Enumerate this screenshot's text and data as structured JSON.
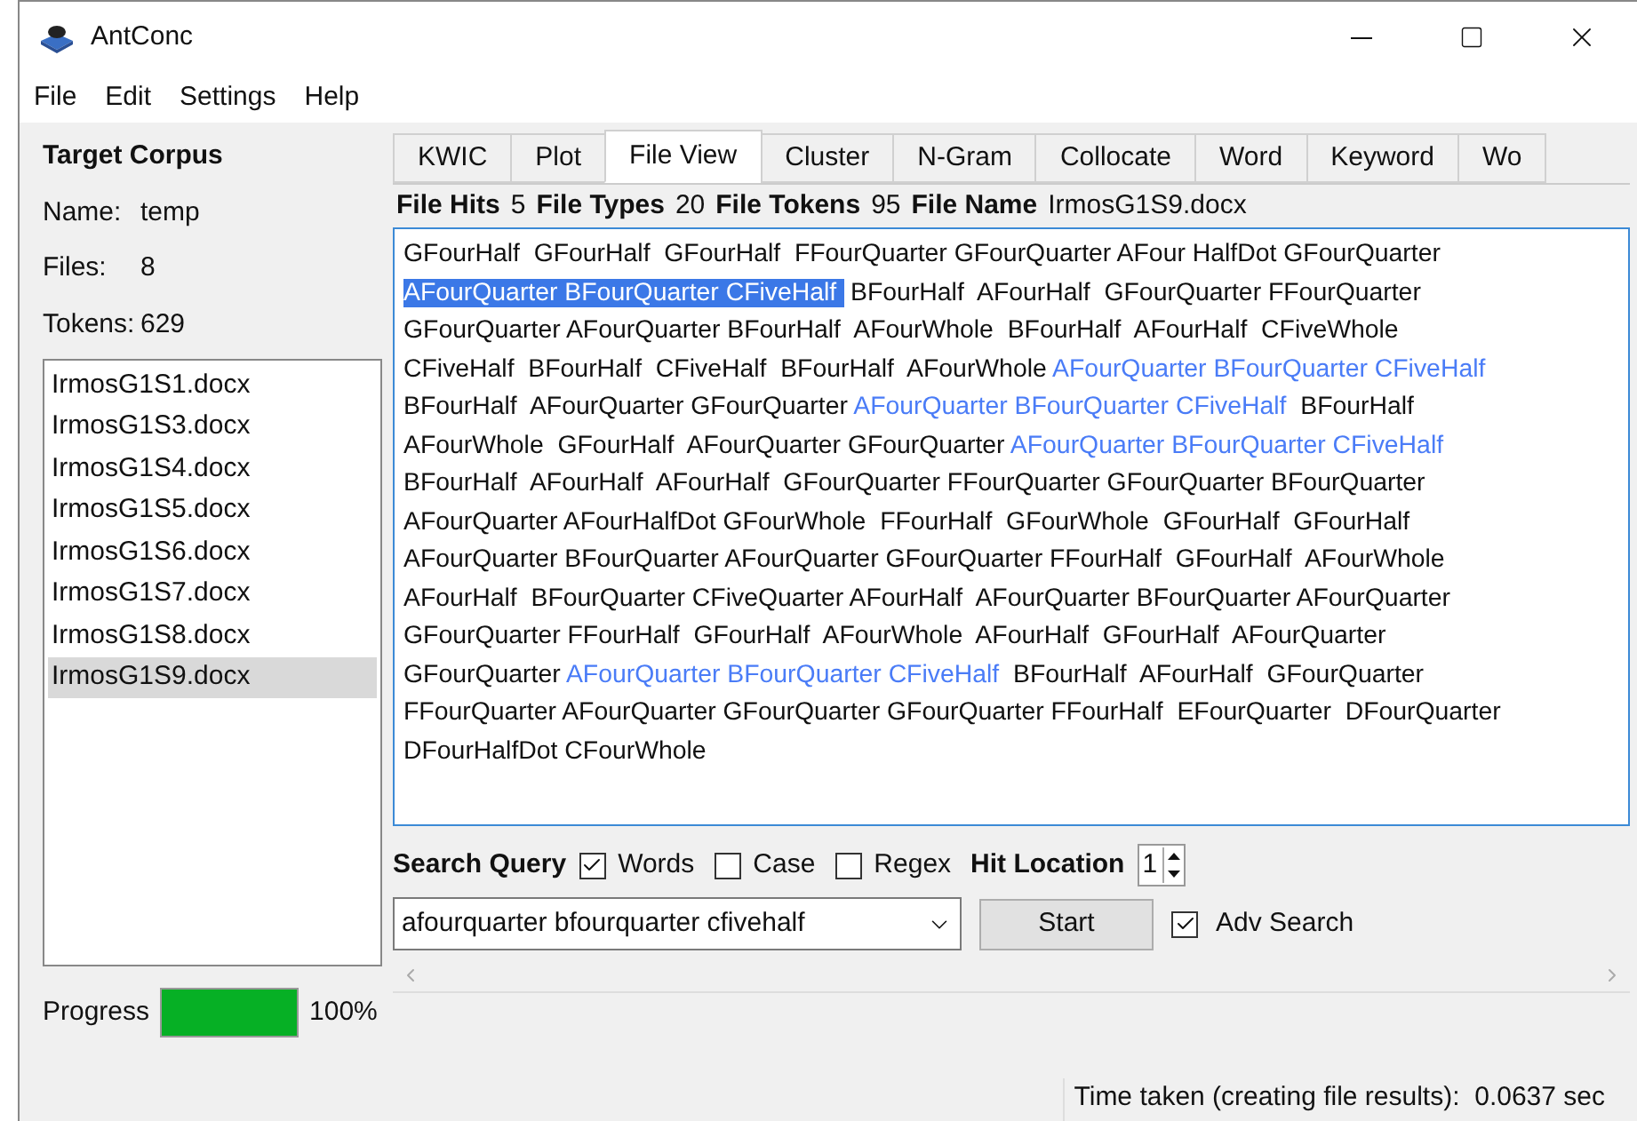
{
  "window": {
    "title": "AntConc"
  },
  "menu": [
    "File",
    "Edit",
    "Settings",
    "Help"
  ],
  "corpus": {
    "heading": "Target Corpus",
    "fields": [
      {
        "label": "Name:",
        "value": "temp"
      },
      {
        "label": "Files:",
        "value": "8"
      },
      {
        "label": "Tokens:",
        "value": "629"
      }
    ],
    "files": [
      {
        "name": "IrmosG1S1.docx",
        "selected": false
      },
      {
        "name": "IrmosG1S3.docx",
        "selected": false
      },
      {
        "name": "IrmosG1S4.docx",
        "selected": false
      },
      {
        "name": "IrmosG1S5.docx",
        "selected": false
      },
      {
        "name": "IrmosG1S6.docx",
        "selected": false
      },
      {
        "name": "IrmosG1S7.docx",
        "selected": false
      },
      {
        "name": "IrmosG1S8.docx",
        "selected": false
      },
      {
        "name": "IrmosG1S9.docx",
        "selected": true
      }
    ]
  },
  "progress": {
    "label": "Progress",
    "level": 1,
    "reading": "100%"
  },
  "tabs": [
    {
      "label": "KWIC",
      "selected": false
    },
    {
      "label": "Plot",
      "selected": false
    },
    {
      "label": "File View",
      "selected": true
    },
    {
      "label": "Cluster",
      "selected": false
    },
    {
      "label": "N-Gram",
      "selected": false
    },
    {
      "label": "Collocate",
      "selected": false
    },
    {
      "label": "Word",
      "selected": false
    },
    {
      "label": "Keyword",
      "selected": false
    },
    {
      "label": "Wo",
      "selected": false
    }
  ],
  "stats": [
    {
      "label": "File Hits",
      "value": "5"
    },
    {
      "label": "File Types",
      "value": "20"
    },
    {
      "label": "File Tokens",
      "value": "95"
    },
    {
      "label": "File Name",
      "value": "IrmosG1S9.docx"
    }
  ],
  "file_view": {
    "lines": [
      [
        {
          "kind": "plain",
          "text": "GFourHalf  GFourHalf  GFourHalf  FFourQuarter GFourQuarter AFour HalfDot GFourQuarter"
        }
      ],
      [
        {
          "kind": "selected",
          "text": "AFourQuarter BFourQuarter CFiveHalf "
        },
        {
          "kind": "plain",
          "text": " BFourHalf  AFourHalf  GFourQuarter FFourQuarter"
        }
      ],
      [
        {
          "kind": "plain",
          "text": "GFourQuarter AFourQuarter BFourHalf  AFourWhole  BFourHalf  AFourHalf  CFiveWhole"
        }
      ],
      [
        {
          "kind": "plain",
          "text": "CFiveHalf  BFourHalf  CFiveHalf  BFourHalf  AFourWhole "
        },
        {
          "kind": "hit",
          "text": "AFourQuarter BFourQuarter CFiveHalf"
        }
      ],
      [
        {
          "kind": "plain",
          "text": "BFourHalf  AFourQuarter GFourQuarter "
        },
        {
          "kind": "hit",
          "text": "AFourQuarter BFourQuarter CFiveHalf"
        },
        {
          "kind": "plain",
          "text": "  BFourHalf"
        }
      ],
      [
        {
          "kind": "plain",
          "text": "AFourWhole  GFourHalf  AFourQuarter GFourQuarter "
        },
        {
          "kind": "hit",
          "text": "AFourQuarter BFourQuarter CFiveHalf"
        }
      ],
      [
        {
          "kind": "plain",
          "text": "BFourHalf  AFourHalf  AFourHalf  GFourQuarter FFourQuarter GFourQuarter BFourQuarter"
        }
      ],
      [
        {
          "kind": "plain",
          "text": "AFourQuarter AFourHalfDot GFourWhole  FFourHalf  GFourWhole  GFourHalf  GFourHalf"
        }
      ],
      [
        {
          "kind": "plain",
          "text": "AFourQuarter BFourQuarter AFourQuarter GFourQuarter FFourHalf  GFourHalf  AFourWhole"
        }
      ],
      [
        {
          "kind": "plain",
          "text": "AFourHalf  BFourQuarter CFiveQuarter AFourHalf  AFourQuarter BFourQuarter AFourQuarter"
        }
      ],
      [
        {
          "kind": "plain",
          "text": "GFourQuarter FFourHalf  GFourHalf  AFourWhole  AFourHalf  GFourHalf  AFourQuarter"
        }
      ],
      [
        {
          "kind": "plain",
          "text": "GFourQuarter "
        },
        {
          "kind": "hit",
          "text": "AFourQuarter BFourQuarter CFiveHalf"
        },
        {
          "kind": "plain",
          "text": "  BFourHalf  AFourHalf  GFourQuarter"
        }
      ],
      [
        {
          "kind": "plain",
          "text": "FFourQuarter AFourQuarter GFourQuarter GFourQuarter FFourHalf  EFourQuarter  DFourQuarter"
        }
      ],
      [
        {
          "kind": "plain",
          "text": "DFourHalfDot CFourWhole"
        }
      ]
    ]
  },
  "search": {
    "label": "Search Query",
    "options": [
      {
        "label": "Words",
        "checked": true
      },
      {
        "label": "Case",
        "checked": false
      },
      {
        "label": "Regex",
        "checked": false
      }
    ],
    "hit_location_label": "Hit Location",
    "hit_location": "1",
    "query": "afourquarter bfourquarter cfivehalf",
    "start": "Start",
    "adv_search": {
      "label": "Adv Search",
      "checked": true
    }
  },
  "status_bar": "Time taken (creating file results):  0.0637 sec"
}
